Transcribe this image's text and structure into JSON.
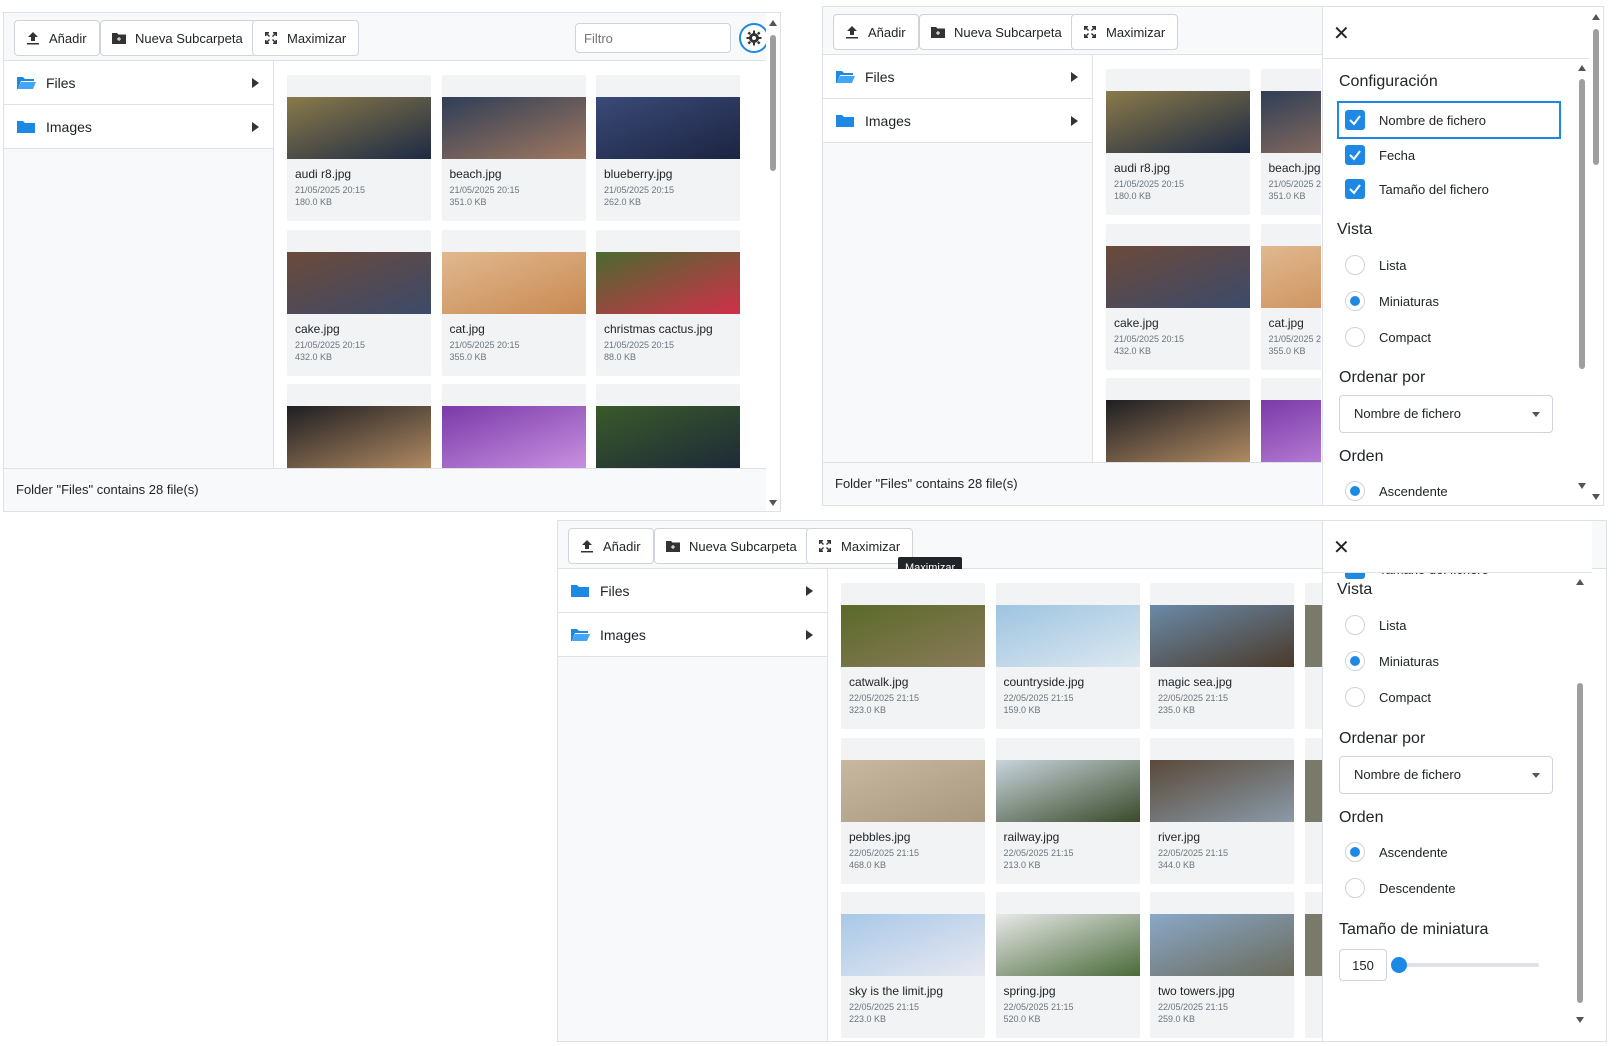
{
  "toolbar": {
    "add_label": "Añadir",
    "new_folder_label": "Nueva Subcarpeta",
    "maximize_label": "Maximizar",
    "filter_placeholder": "Filtro"
  },
  "sidebar": {
    "items": [
      {
        "label": "Files"
      },
      {
        "label": "Images"
      }
    ]
  },
  "status_text": "Folder \"Files\" contains 28 file(s)",
  "tooltip": "Maximizar",
  "files_page1": [
    {
      "name": "audi r8.jpg",
      "date": "21/05/2025 20:15",
      "size": "180.0 KB",
      "colors": [
        "#8a7a4a",
        "#1d2a44"
      ]
    },
    {
      "name": "beach.jpg",
      "date": "21/05/2025 20:15",
      "size": "351.0 KB",
      "colors": [
        "#2f3e56",
        "#a07860"
      ]
    },
    {
      "name": "blueberry.jpg",
      "date": "21/05/2025 20:15",
      "size": "262.0 KB",
      "colors": [
        "#3a4a78",
        "#1c2440"
      ]
    },
    {
      "name": "cake.jpg",
      "date": "21/05/2025 20:15",
      "size": "432.0 KB",
      "colors": [
        "#6b4a3a",
        "#3c4a6a"
      ]
    },
    {
      "name": "cat.jpg",
      "date": "21/05/2025 20:15",
      "size": "355.0 KB",
      "colors": [
        "#e0b890",
        "#c98a52"
      ]
    },
    {
      "name": "christmas cactus.jpg",
      "date": "21/05/2025 20:15",
      "size": "88.0 KB",
      "colors": [
        "#4a6a30",
        "#d0304a"
      ]
    },
    {
      "name": "",
      "date": "",
      "size": "",
      "colors": [
        "#1e1e22",
        "#b08a62"
      ]
    },
    {
      "name": "",
      "date": "",
      "size": "",
      "colors": [
        "#7a3aa8",
        "#c890e0"
      ]
    },
    {
      "name": "",
      "date": "",
      "size": "",
      "colors": [
        "#3a5a2a",
        "#1e2a38"
      ]
    }
  ],
  "files_page2": [
    {
      "name": "catwalk.jpg",
      "date": "22/05/2025 21:15",
      "size": "323.0 KB",
      "colors": [
        "#5a6a2a",
        "#8a7a5a"
      ]
    },
    {
      "name": "countryside.jpg",
      "date": "22/05/2025 21:15",
      "size": "159.0 KB",
      "colors": [
        "#9ec4e0",
        "#dce8f0"
      ]
    },
    {
      "name": "magic sea.jpg",
      "date": "22/05/2025 21:15",
      "size": "235.0 KB",
      "colors": [
        "#6a8aa8",
        "#4a3a2a"
      ]
    },
    {
      "name": "pebbles.jpg",
      "date": "22/05/2025 21:15",
      "size": "468.0 KB",
      "colors": [
        "#c8b8a0",
        "#a89880"
      ]
    },
    {
      "name": "railway.jpg",
      "date": "22/05/2025 21:15",
      "size": "213.0 KB",
      "colors": [
        "#c8d4dc",
        "#3a4a2a"
      ]
    },
    {
      "name": "river.jpg",
      "date": "22/05/2025 21:15",
      "size": "344.0 KB",
      "colors": [
        "#5a4a3a",
        "#8a9aa8"
      ]
    },
    {
      "name": "sky is the limit.jpg",
      "date": "22/05/2025 21:15",
      "size": "223.0 KB",
      "colors": [
        "#a8c8e8",
        "#e8e8f0"
      ]
    },
    {
      "name": "spring.jpg",
      "date": "22/05/2025 21:15",
      "size": "520.0 KB",
      "colors": [
        "#e8e8e8",
        "#4a6a3a"
      ]
    },
    {
      "name": "two towers.jpg",
      "date": "22/05/2025 21:15",
      "size": "259.0 KB",
      "colors": [
        "#8aa8c8",
        "#6a6a5a"
      ]
    }
  ],
  "config": {
    "title": "Configuración",
    "checkboxes": [
      {
        "label": "Nombre de fichero",
        "checked": true
      },
      {
        "label": "Fecha",
        "checked": true
      },
      {
        "label": "Tamaño del fichero",
        "checked": true
      }
    ],
    "view_title": "Vista",
    "view_options": [
      {
        "label": "Lista",
        "selected": false
      },
      {
        "label": "Miniaturas",
        "selected": true
      },
      {
        "label": "Compact",
        "selected": false
      }
    ],
    "sort_title": "Ordenar por",
    "sort_value": "Nombre de fichero",
    "order_title": "Orden",
    "order_options": [
      {
        "label": "Ascendente",
        "selected": true
      },
      {
        "label": "Descendente",
        "selected": false
      }
    ],
    "thumb_title": "Tamaño de miniatura",
    "thumb_size": "150",
    "thumb_slider_fraction": 0.0
  },
  "colors": {
    "accent": "#1e88e5",
    "folder": "#1e88e5"
  }
}
